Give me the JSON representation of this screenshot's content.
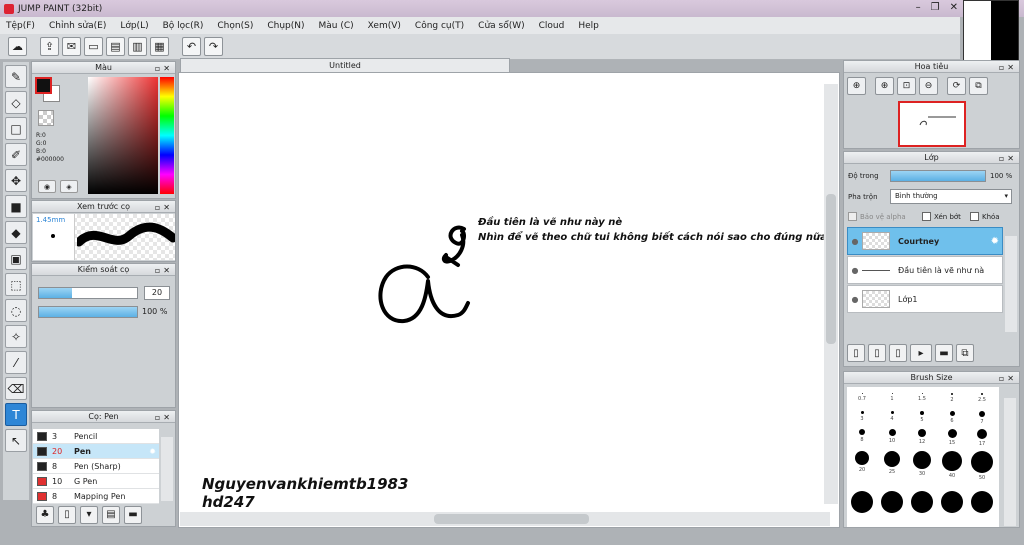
{
  "window": {
    "title": "JUMP PAINT (32bit)",
    "controls": [
      "–",
      "❐",
      "✕"
    ]
  },
  "menu": [
    "Tệp(F)",
    "Chỉnh sửa(E)",
    "Lớp(L)",
    "Bộ lọc(R)",
    "Chọn(S)",
    "Chụp(N)",
    "Màu (C)",
    "Xem(V)",
    "Công cụ(T)",
    "Cửa sổ(W)",
    "Cloud",
    "Help"
  ],
  "color_panel": {
    "title": "Màu",
    "r": "R:0",
    "g": "G:0",
    "b": "B:0",
    "hex": "#000000"
  },
  "brush_preview": {
    "title": "Xem trước cọ",
    "size": "1.45mm"
  },
  "brush_control": {
    "title": "Kiểm soát cọ",
    "size_value": "20",
    "size_fill": 0.34,
    "opacity_value": "100 %",
    "opacity_fill": 1.0
  },
  "brush_list": {
    "title": "Cọ: Pen",
    "items": [
      {
        "num": "3",
        "name": "Pencil",
        "color": "#222222"
      },
      {
        "num": "20",
        "name": "Pen",
        "color": "#222222",
        "selected": true
      },
      {
        "num": "8",
        "name": "Pen (Sharp)",
        "color": "#222222"
      },
      {
        "num": "10",
        "name": "G Pen",
        "color": "#e03030"
      },
      {
        "num": "8",
        "name": "Mapping Pen",
        "color": "#e03030"
      }
    ]
  },
  "document": {
    "tab": "Untitled"
  },
  "canvas": {
    "note1": "Đầu tiên là vẽ như này nè",
    "note2": "Nhìn để vẽ theo chữ tui không biết cách nói sao cho đúng nữa",
    "sig1": "Nguyenvankhiemtb1983",
    "sig2": "hd247"
  },
  "navigator": {
    "title": "Hoa tiêu"
  },
  "layers": {
    "title": "Lớp",
    "opacity_label": "Độ trong",
    "opacity_value": "100 %",
    "blend_label": "Pha trộn",
    "blend_value": "Bình thường",
    "protect_alpha": "Bảo vệ alpha",
    "clipping": "Xén bớt",
    "lock": "Khóa",
    "items": [
      {
        "name": "Courtney",
        "selected": true
      },
      {
        "name": "Đầu tiên là vẽ như nà"
      },
      {
        "name": "Lớp1"
      }
    ]
  },
  "brush_size": {
    "title": "Brush Size",
    "rows": [
      [
        "0.7",
        "1",
        "1.5",
        "2",
        "2.5"
      ],
      [
        "3",
        "4",
        "5",
        "6",
        "7"
      ],
      [
        "8",
        "10",
        "12",
        "15",
        "17"
      ],
      [
        "20",
        "25",
        "30",
        "40",
        "50"
      ],
      [
        "",
        "",
        "",
        "",
        ""
      ]
    ]
  }
}
